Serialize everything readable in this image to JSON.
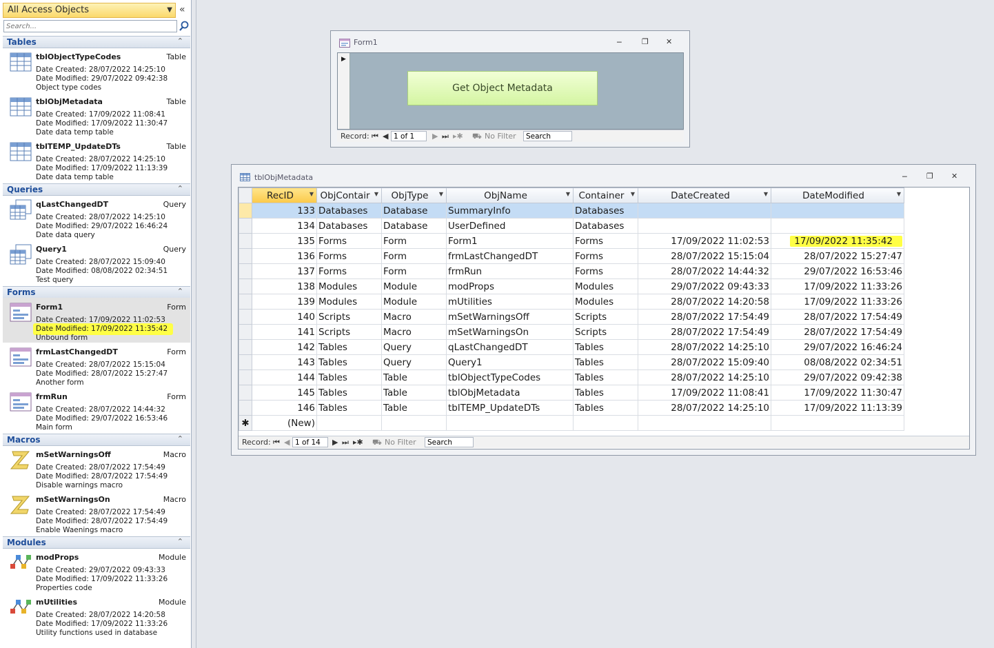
{
  "nav": {
    "title": "All Access Objects",
    "search_placeholder": "Search...",
    "groups": {
      "tables": "Tables",
      "queries": "Queries",
      "forms": "Forms",
      "macros": "Macros",
      "modules": "Modules"
    },
    "objects": [
      {
        "name": "tblObjectTypeCodes",
        "type": "Table",
        "created": "Date Created: 28/07/2022 14:25:10",
        "modified": "Date Modified: 29/07/2022 09:42:38",
        "desc": "Object type codes"
      },
      {
        "name": "tblObjMetadata",
        "type": "Table",
        "created": "Date Created: 17/09/2022 11:08:41",
        "modified": "Date Modified: 17/09/2022 11:30:47",
        "desc": "Date data temp table"
      },
      {
        "name": "tblTEMP_UpdateDTs",
        "type": "Table",
        "created": "Date Created: 28/07/2022 14:25:10",
        "modified": "Date Modified: 17/09/2022 11:13:39",
        "desc": "Date data temp table"
      },
      {
        "name": "qLastChangedDT",
        "type": "Query",
        "created": "Date Created: 28/07/2022 14:25:10",
        "modified": "Date Modified: 29/07/2022 16:46:24",
        "desc": "Date data query"
      },
      {
        "name": "Query1",
        "type": "Query",
        "created": "Date Created: 28/07/2022 15:09:40",
        "modified": "Date Modified: 08/08/2022 02:34:51",
        "desc": "Test query"
      },
      {
        "name": "Form1",
        "type": "Form",
        "created": "Date Created: 17/09/2022 11:02:53",
        "modified": "Date Modified: 17/09/2022 11:35:42",
        "desc": "Unbound form"
      },
      {
        "name": "frmLastChangedDT",
        "type": "Form",
        "created": "Date Created: 28/07/2022 15:15:04",
        "modified": "Date Modified: 28/07/2022 15:27:47",
        "desc": "Another form"
      },
      {
        "name": "frmRun",
        "type": "Form",
        "created": "Date Created: 28/07/2022 14:44:32",
        "modified": "Date Modified: 29/07/2022 16:53:46",
        "desc": "Main form"
      },
      {
        "name": "mSetWarningsOff",
        "type": "Macro",
        "created": "Date Created: 28/07/2022 17:54:49",
        "modified": "Date Modified: 28/07/2022 17:54:49",
        "desc": "Disable warnings macro"
      },
      {
        "name": "mSetWarningsOn",
        "type": "Macro",
        "created": "Date Created: 28/07/2022 17:54:49",
        "modified": "Date Modified: 28/07/2022 17:54:49",
        "desc": "Enable Waenings macro"
      },
      {
        "name": "modProps",
        "type": "Module",
        "created": "Date Created: 29/07/2022 09:43:33",
        "modified": "Date Modified: 17/09/2022 11:33:26",
        "desc": "Properties code"
      },
      {
        "name": "mUtilities",
        "type": "Module",
        "created": "Date Created: 28/07/2022 14:20:58",
        "modified": "Date Modified: 17/09/2022 11:33:26",
        "desc": "Utility functions used in database"
      }
    ]
  },
  "form1": {
    "title": "Form1",
    "button_label": "Get Object Metadata",
    "nav": {
      "record_label": "Record:",
      "position": "1 of 1",
      "filter": "No Filter",
      "search": "Search"
    }
  },
  "datasheet": {
    "title": "tblObjMetadata",
    "columns": [
      "RecID",
      "ObjContair",
      "ObjType",
      "ObjName",
      "Container",
      "DateCreated",
      "DateModified"
    ],
    "rows": [
      [
        "133",
        "Databases",
        "Database",
        "SummaryInfo",
        "Databases",
        "",
        ""
      ],
      [
        "134",
        "Databases",
        "Database",
        "UserDefined",
        "Databases",
        "",
        ""
      ],
      [
        "135",
        "Forms",
        "Form",
        "Form1",
        "Forms",
        "17/09/2022 11:02:53",
        "17/09/2022 11:35:42"
      ],
      [
        "136",
        "Forms",
        "Form",
        "frmLastChangedDT",
        "Forms",
        "28/07/2022 15:15:04",
        "28/07/2022 15:27:47"
      ],
      [
        "137",
        "Forms",
        "Form",
        "frmRun",
        "Forms",
        "28/07/2022 14:44:32",
        "29/07/2022 16:53:46"
      ],
      [
        "138",
        "Modules",
        "Module",
        "modProps",
        "Modules",
        "29/07/2022 09:43:33",
        "17/09/2022 11:33:26"
      ],
      [
        "139",
        "Modules",
        "Module",
        "mUtilities",
        "Modules",
        "28/07/2022 14:20:58",
        "17/09/2022 11:33:26"
      ],
      [
        "140",
        "Scripts",
        "Macro",
        "mSetWarningsOff",
        "Scripts",
        "28/07/2022 17:54:49",
        "28/07/2022 17:54:49"
      ],
      [
        "141",
        "Scripts",
        "Macro",
        "mSetWarningsOn",
        "Scripts",
        "28/07/2022 17:54:49",
        "28/07/2022 17:54:49"
      ],
      [
        "142",
        "Tables",
        "Query",
        "qLastChangedDT",
        "Tables",
        "28/07/2022 14:25:10",
        "29/07/2022 16:46:24"
      ],
      [
        "143",
        "Tables",
        "Query",
        "Query1",
        "Tables",
        "28/07/2022 15:09:40",
        "08/08/2022 02:34:51"
      ],
      [
        "144",
        "Tables",
        "Table",
        "tblObjectTypeCodes",
        "Tables",
        "28/07/2022 14:25:10",
        "29/07/2022 09:42:38"
      ],
      [
        "145",
        "Tables",
        "Table",
        "tblObjMetadata",
        "Tables",
        "17/09/2022 11:08:41",
        "17/09/2022 11:30:47"
      ],
      [
        "146",
        "Tables",
        "Table",
        "tblTEMP_UpdateDTs",
        "Tables",
        "28/07/2022 14:25:10",
        "17/09/2022 11:13:39"
      ]
    ],
    "new_row_label": "(New)",
    "new_row_marker": "✱",
    "nav": {
      "record_label": "Record:",
      "position": "1 of 14",
      "filter": "No Filter",
      "search": "Search"
    }
  },
  "colors": {
    "highlight": "#ffff45",
    "group_heading": "#1f4e9a",
    "button_green": "#d4f5a2"
  }
}
